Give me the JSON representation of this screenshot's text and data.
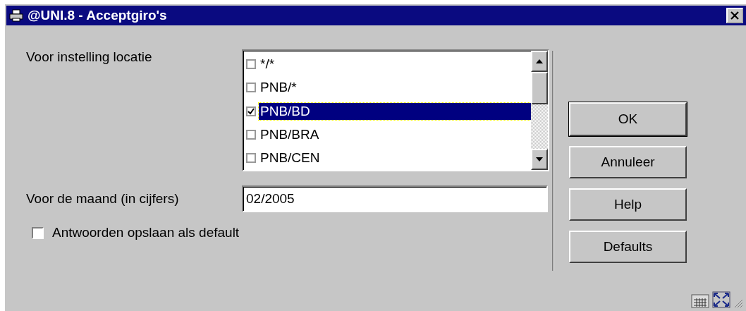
{
  "window": {
    "title": "@UNI.8 - Acceptgiro's"
  },
  "location": {
    "label": "Voor instelling locatie",
    "items": [
      {
        "label": "*/*",
        "checked": false,
        "selected": false
      },
      {
        "label": "PNB/*",
        "checked": false,
        "selected": false
      },
      {
        "label": "PNB/BD",
        "checked": true,
        "selected": true
      },
      {
        "label": "PNB/BRA",
        "checked": false,
        "selected": false
      },
      {
        "label": "PNB/CEN",
        "checked": false,
        "selected": false
      }
    ]
  },
  "month": {
    "label": "Voor de maand (in cijfers)",
    "value": "02/2005"
  },
  "save_default": {
    "label": "Antwoorden opslaan als default",
    "checked": false
  },
  "buttons": [
    {
      "label": "OK",
      "default": true
    },
    {
      "label": "Annuleer",
      "default": false
    },
    {
      "label": "Help",
      "default": false
    },
    {
      "label": "Defaults",
      "default": false
    }
  ]
}
